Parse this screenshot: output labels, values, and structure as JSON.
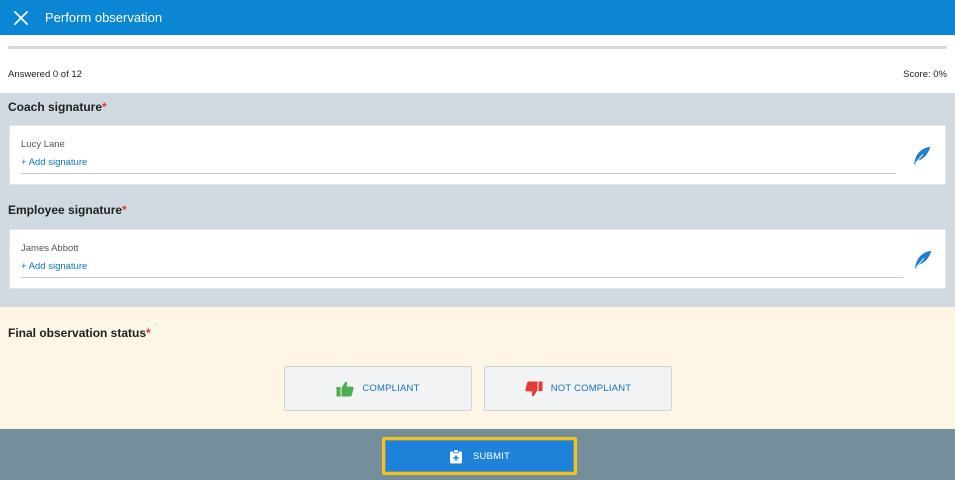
{
  "header": {
    "title": "Perform observation",
    "icon": "close-icon"
  },
  "progress": {
    "fraction": 0,
    "answered_text": "Answered 0 of 12",
    "score_text": "Score: 0%"
  },
  "coach_signature": {
    "title": "Coach signature",
    "required_mark": "*",
    "name": "Lucy Lane",
    "add_label": "+ Add signature",
    "icon": "feather-pen-icon"
  },
  "employee_signature": {
    "title": "Employee signature",
    "required_mark": "*",
    "name": "James Abbott",
    "add_label": "+ Add signature",
    "icon": "feather-pen-icon"
  },
  "final_status": {
    "title": "Final observation status",
    "required_mark": "*",
    "compliant_label": "COMPLIANT",
    "compliant_icon": "thumbs-up-icon",
    "not_compliant_label": "NOT COMPLIANT",
    "not_compliant_icon": "thumbs-down-icon"
  },
  "footer": {
    "submit_label": "SUBMIT",
    "submit_icon": "clipboard-plus-icon"
  },
  "colors": {
    "primary": "#0b86d4",
    "signature_bg": "#d0d9df",
    "final_bg": "#fdf6e6",
    "footer_bg": "#748f9c",
    "highlight": "#f4c21b",
    "thumbs_up": "#4caf50",
    "thumbs_down": "#e53935",
    "required": "#e53935"
  }
}
